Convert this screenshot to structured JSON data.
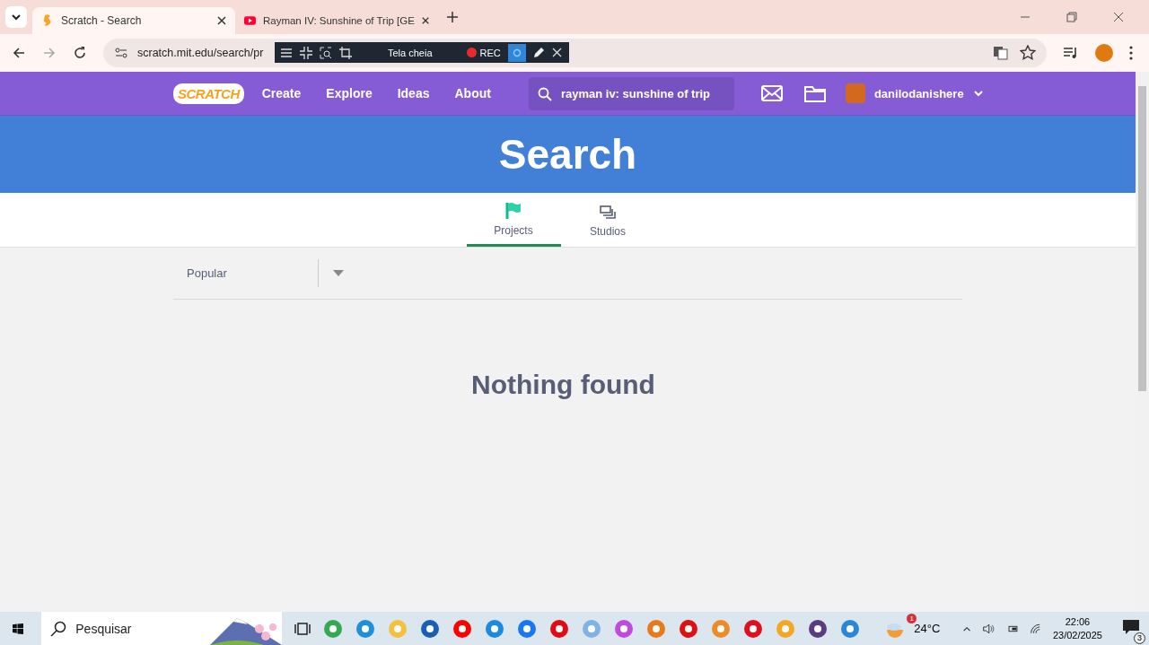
{
  "browser": {
    "tabs": [
      {
        "title": "Scratch - Search",
        "selected": true
      },
      {
        "title": "Rayman IV: Sunshine of Trip [GE",
        "selected": false
      }
    ],
    "url": "scratch.mit.edu/search/pr"
  },
  "recorder": {
    "label": "Tela cheia",
    "rec": "REC"
  },
  "nav": {
    "logo": "SCRATCH",
    "links": [
      "Create",
      "Explore",
      "Ideas",
      "About"
    ],
    "search": {
      "value": "rayman iv: sunshine of trip"
    },
    "username": "danilodanishere"
  },
  "header": {
    "title": "Search"
  },
  "tabs": [
    {
      "label": "Projects",
      "kind": "projects",
      "selected": true
    },
    {
      "label": "Studios",
      "kind": "studios",
      "selected": false
    }
  ],
  "sort": {
    "value": "Popular"
  },
  "message": "Nothing found",
  "taskbar": {
    "search_placeholder": "Pesquisar",
    "weather": "24°C",
    "weather_badge": "1",
    "time": "22:06",
    "date": "23/02/2025",
    "notifications": "3"
  }
}
